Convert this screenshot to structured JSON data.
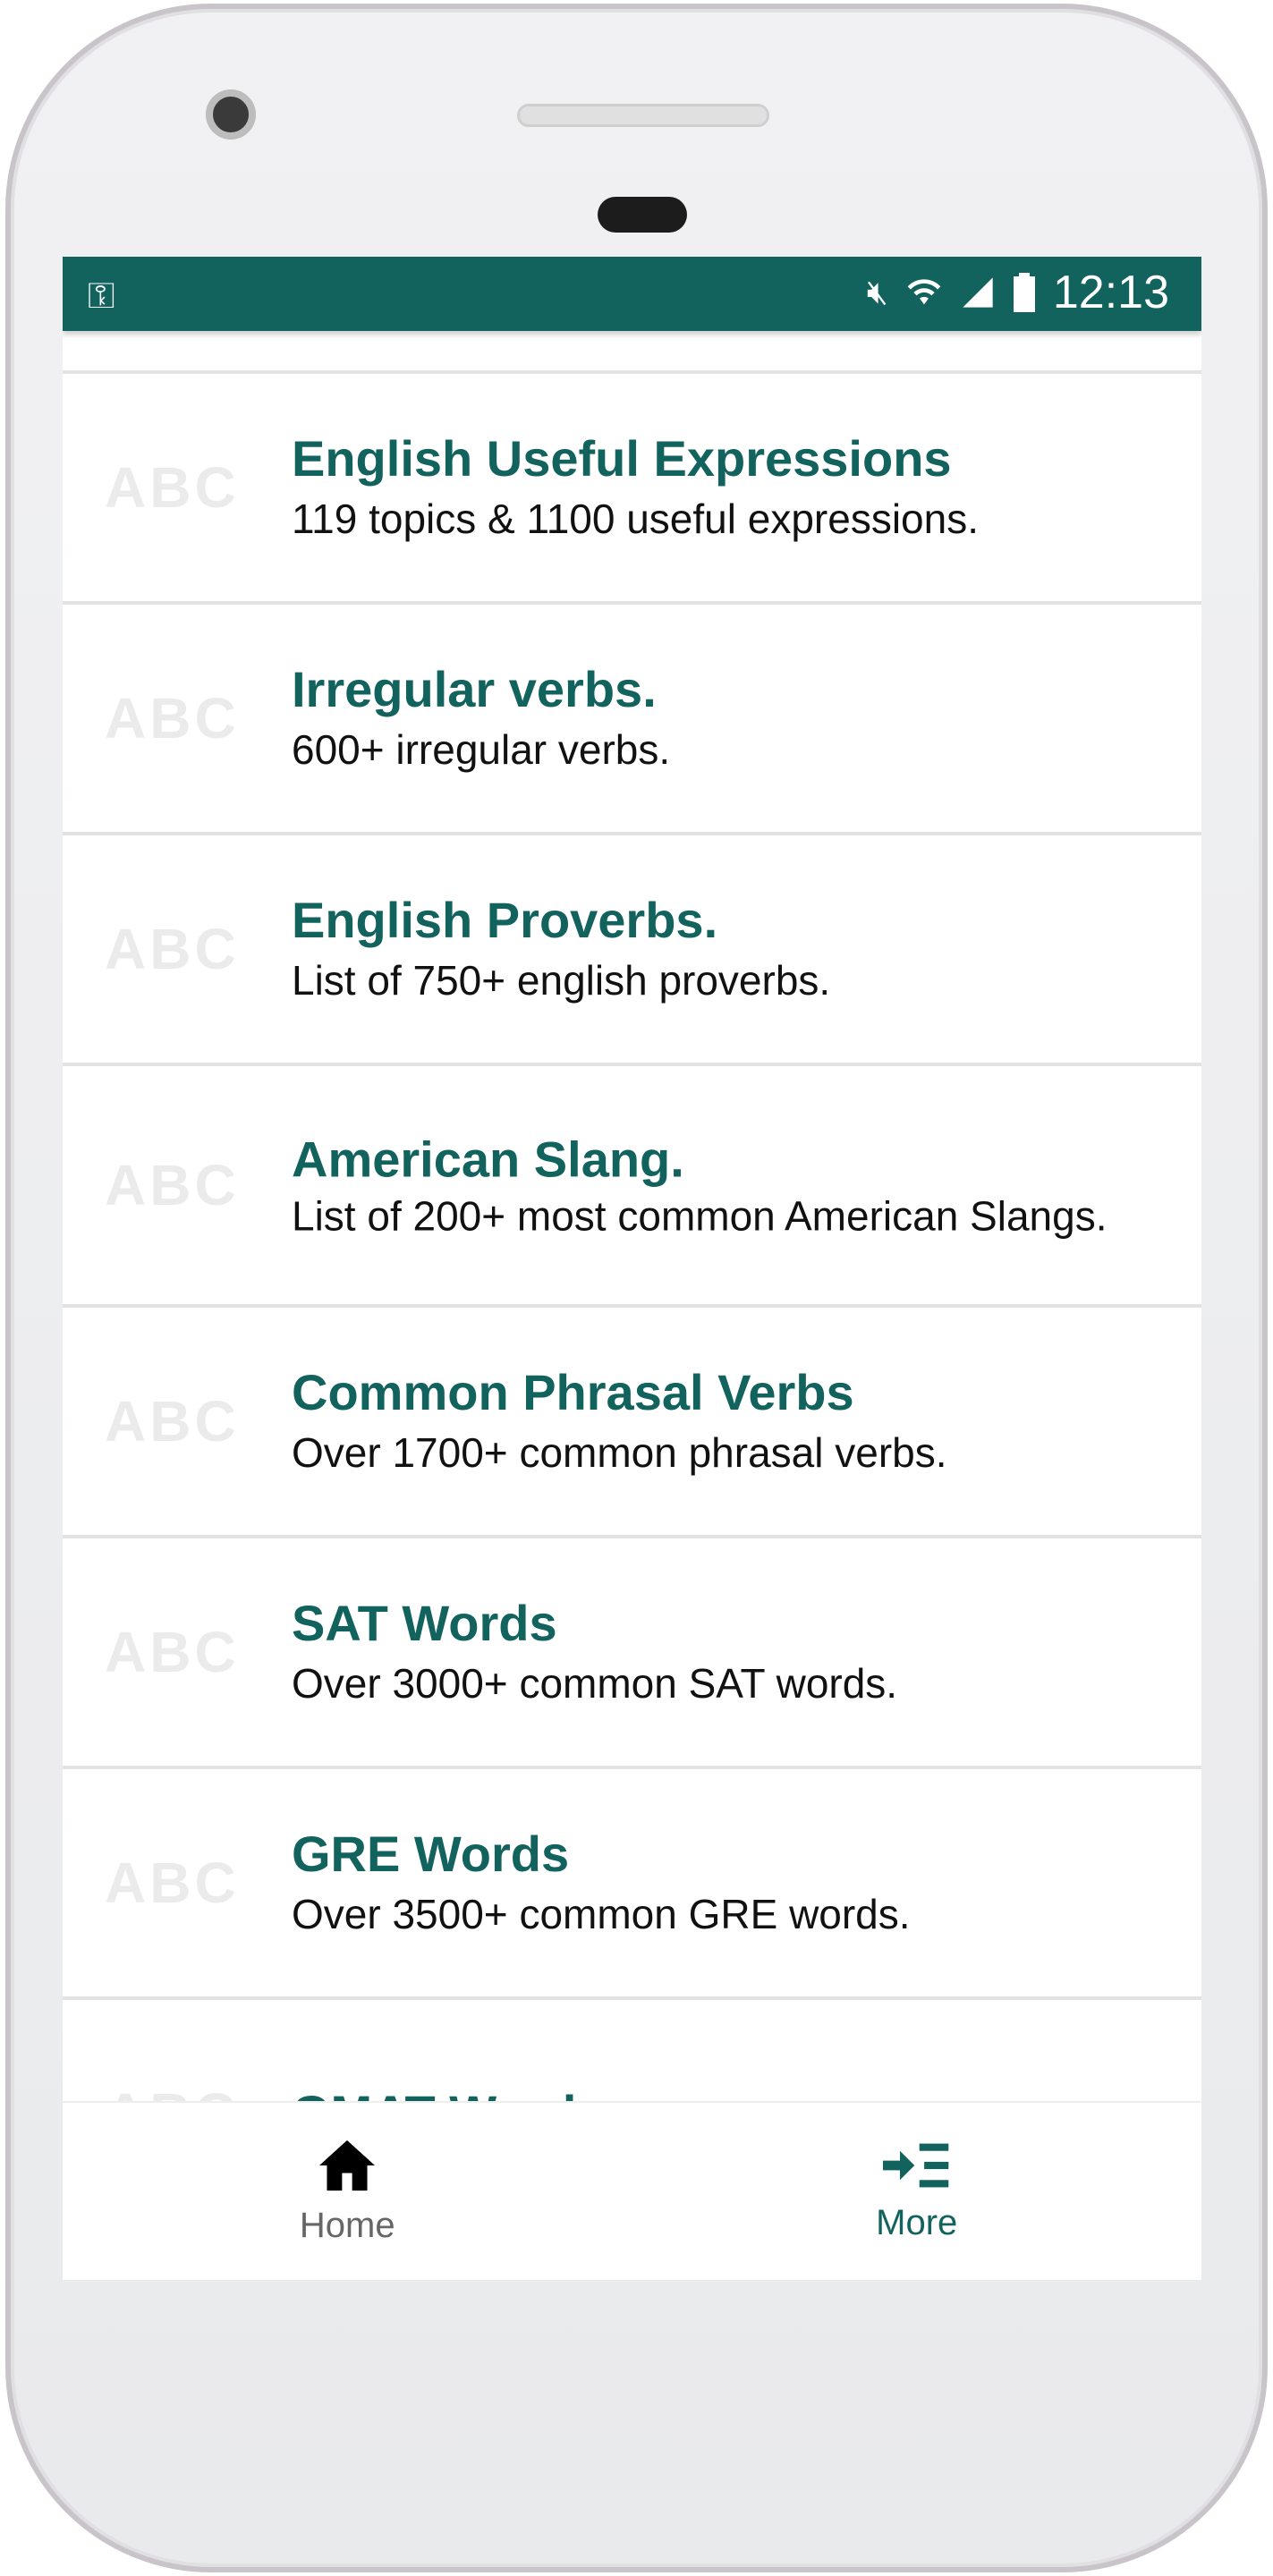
{
  "status_bar": {
    "time": "12:13",
    "icons": [
      "vpn-key-icon",
      "mute-icon",
      "wifi-icon",
      "signal-icon",
      "battery-icon"
    ]
  },
  "items": [
    {
      "title": "English Useful Expressions",
      "subtitle": "119 topics & 1100 useful expressions.",
      "icon_text": "ABC"
    },
    {
      "title": "Irregular verbs.",
      "subtitle": "600+ irregular verbs.",
      "icon_text": "ABC"
    },
    {
      "title": "English Proverbs.",
      "subtitle": "List of 750+ english proverbs.",
      "icon_text": "ABC"
    },
    {
      "title": "American Slang.",
      "subtitle": "List of 200+ most common American Slangs.",
      "icon_text": "ABC"
    },
    {
      "title": "Common Phrasal Verbs",
      "subtitle": "Over 1700+ common phrasal verbs.",
      "icon_text": "ABC"
    },
    {
      "title": "SAT Words",
      "subtitle": "Over 3000+ common SAT words.",
      "icon_text": "ABC"
    },
    {
      "title": "GRE Words",
      "subtitle": "Over 3500+ common GRE words.",
      "icon_text": "ABC"
    },
    {
      "title": "GMAT Words",
      "subtitle": "",
      "icon_text": "ABC"
    }
  ],
  "nav": {
    "home": "Home",
    "more": "More",
    "active": "More"
  },
  "colors": {
    "primary": "#12625d",
    "inactive": "#666666"
  }
}
